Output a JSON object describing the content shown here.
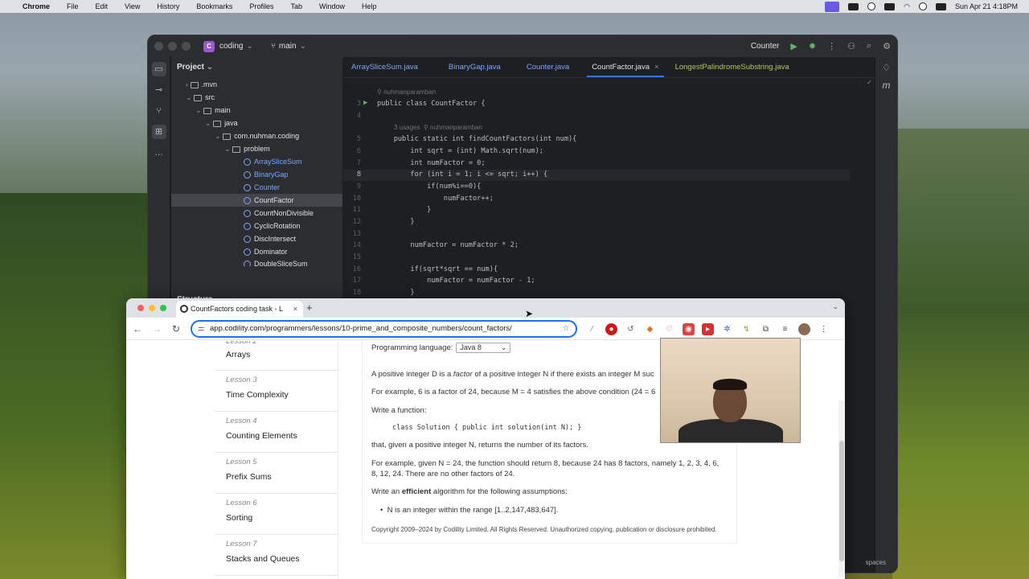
{
  "menubar": {
    "app": "Chrome",
    "items": [
      "File",
      "Edit",
      "View",
      "History",
      "Bookmarks",
      "Profiles",
      "Tab",
      "Window",
      "Help"
    ],
    "clock": "Sun Apr 21  4:18PM"
  },
  "ide": {
    "project_badge": "C",
    "project": "coding",
    "branch": "main",
    "run_config": "Counter",
    "pane_title": "Project",
    "structure_title": "Structure",
    "tree": [
      {
        "label": ".mvn",
        "indent": 1,
        "kind": "folder"
      },
      {
        "label": "src",
        "indent": 1,
        "kind": "folder"
      },
      {
        "label": "main",
        "indent": 2,
        "kind": "folder"
      },
      {
        "label": "java",
        "indent": 3,
        "kind": "folder"
      },
      {
        "label": "com.nuhman.coding",
        "indent": 4,
        "kind": "folder"
      },
      {
        "label": "problem",
        "indent": 5,
        "kind": "folder"
      },
      {
        "label": "ArraySliceSum",
        "indent": 6,
        "kind": "file"
      },
      {
        "label": "BinaryGap",
        "indent": 6,
        "kind": "file"
      },
      {
        "label": "Counter",
        "indent": 6,
        "kind": "file"
      },
      {
        "label": "CountFactor",
        "indent": 6,
        "kind": "file",
        "selected": true
      },
      {
        "label": "CountNonDivisible",
        "indent": 6,
        "kind": "file"
      },
      {
        "label": "CyclicRotation",
        "indent": 6,
        "kind": "file"
      },
      {
        "label": "DiscIntersect",
        "indent": 6,
        "kind": "file"
      },
      {
        "label": "Dominator",
        "indent": 6,
        "kind": "file"
      },
      {
        "label": "DoubleSliceSum",
        "indent": 6,
        "kind": "file"
      }
    ],
    "tabs": [
      "ArraySliceSum.java",
      "BinaryGap.java",
      "Counter.java",
      "CountFactor.java",
      "LongestPalindromeSubstring.java"
    ],
    "active_tab": "CountFactor.java",
    "author_hint": "nuhmanparamban",
    "usages_hint": "3 usages",
    "usages_author": "nuhmanparamban",
    "lines": [
      {
        "n": "3",
        "text": "public class CountFactor {"
      },
      {
        "n": "4",
        "text": ""
      },
      {
        "n": "5",
        "text": "    public static int findCountFactors(int num){"
      },
      {
        "n": "6",
        "text": "        int sqrt = (int) Math.sqrt(num);"
      },
      {
        "n": "7",
        "text": "        int numFactor = 0;"
      },
      {
        "n": "8",
        "text": "        for (int i = 1; i <= sqrt; i++) {"
      },
      {
        "n": "9",
        "text": "            if(num%i==0){"
      },
      {
        "n": "10",
        "text": "                numFactor++;"
      },
      {
        "n": "11",
        "text": "            }"
      },
      {
        "n": "12",
        "text": "        }"
      },
      {
        "n": "13",
        "text": ""
      },
      {
        "n": "14",
        "text": "        numFactor = numFactor * 2;"
      },
      {
        "n": "15",
        "text": ""
      },
      {
        "n": "16",
        "text": "        if(sqrt*sqrt == num){"
      },
      {
        "n": "17",
        "text": "            numFactor = numFactor - 1;"
      },
      {
        "n": "18",
        "text": "        }"
      }
    ],
    "status_right": "spaces"
  },
  "browser": {
    "tab_title": "CountFactors coding task - L",
    "url": "app.codility.com/programmers/lessons/10-prime_and_composite_numbers/count_factors/",
    "lessons": [
      {
        "num": "Lesson 2",
        "title": "Arrays"
      },
      {
        "num": "Lesson 3",
        "title": "Time Complexity"
      },
      {
        "num": "Lesson 4",
        "title": "Counting Elements"
      },
      {
        "num": "Lesson 5",
        "title": "Prefix Sums"
      },
      {
        "num": "Lesson 6",
        "title": "Sorting"
      },
      {
        "num": "Lesson 7",
        "title": "Stacks and Queues"
      }
    ],
    "task": {
      "lang_label": "Programming language:",
      "lang_value": "Java 8",
      "p1_a": "A positive integer D is a ",
      "p1_em": "factor",
      "p1_b": " of a positive integer N if there exists an integer M suc",
      "p2": "For example, 6 is a factor of 24, because M = 4 satisfies the above condition (24 = 6",
      "p3": "Write a function:",
      "code": "class Solution { public int solution(int N); }",
      "p4": "that, given a positive integer N, returns the number of its factors.",
      "p5a": "For example, given N = 24, the function should return 8, because 24 has 8 factors, namely 1, 2, 3, 4, 6,",
      "p5b": "8, 12, 24. There are no other factors of 24.",
      "p6a": "Write an ",
      "p6b": "efficient",
      "p6c": " algorithm for the following assumptions:",
      "bullet": "N is an integer within the range [1..2,147,483,647].",
      "copyright": "Copyright 2009–2024 by Codility Limited. All Rights Reserved. Unauthorized copying, publication or disclosure prohibited."
    }
  },
  "colors": {
    "accent": "#3574f0",
    "link": "#7aa7ff",
    "run": "#5fb85f",
    "omnibox": "#1a73e8"
  }
}
